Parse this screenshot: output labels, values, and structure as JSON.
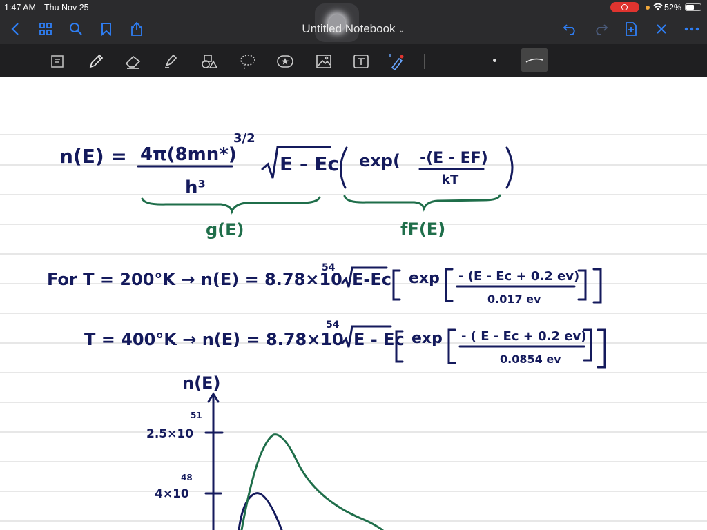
{
  "status": {
    "time": "1:47 AM",
    "date": "Thu Nov 25",
    "battery": "52%"
  },
  "app": {
    "title": "Untitled Notebook",
    "title_chevron": "⌄"
  },
  "notes": {
    "eq1_lhs": "n(E) =",
    "eq1_numerator": "4π(8mn*)",
    "eq1_exponent": "3/2",
    "eq1_denominator": "h³",
    "eq1_sqrt": "E - Ec",
    "eq1_exp": "exp(",
    "eq1_frac_num": "-(E - EF)",
    "eq1_frac_den": "kT",
    "label_g": "g(E)",
    "label_f": "fF(E)",
    "line2_prefix": "For  T = 200°K → n(E) = 8.78×10",
    "line2_exp": "54",
    "line2_sqrt": "E-Ec",
    "line2_exp_word": "exp",
    "line2_num": "- (E - Ec + 0.2 ev)",
    "line2_den": "0.017 ev",
    "line3_prefix": "T = 400°K → n(E) = 8.78×10",
    "line3_exp": "54",
    "line3_sqrt": "E - Ec",
    "line3_exp_word": "exp",
    "line3_num": "- ( E - Ec + 0.2 ev)",
    "line3_den": "0.0854 ev",
    "graph_ylabel": "n(E)",
    "graph_tick1": "2.5×10",
    "graph_tick1_exp": "51",
    "graph_tick2": "4×10",
    "graph_tick2_exp": "48"
  },
  "colors": {
    "ink_blue": "#141a5c",
    "ink_green": "#1f6e4a",
    "accent": "#2f7ff5",
    "toolbar": "#2b2b2d"
  }
}
